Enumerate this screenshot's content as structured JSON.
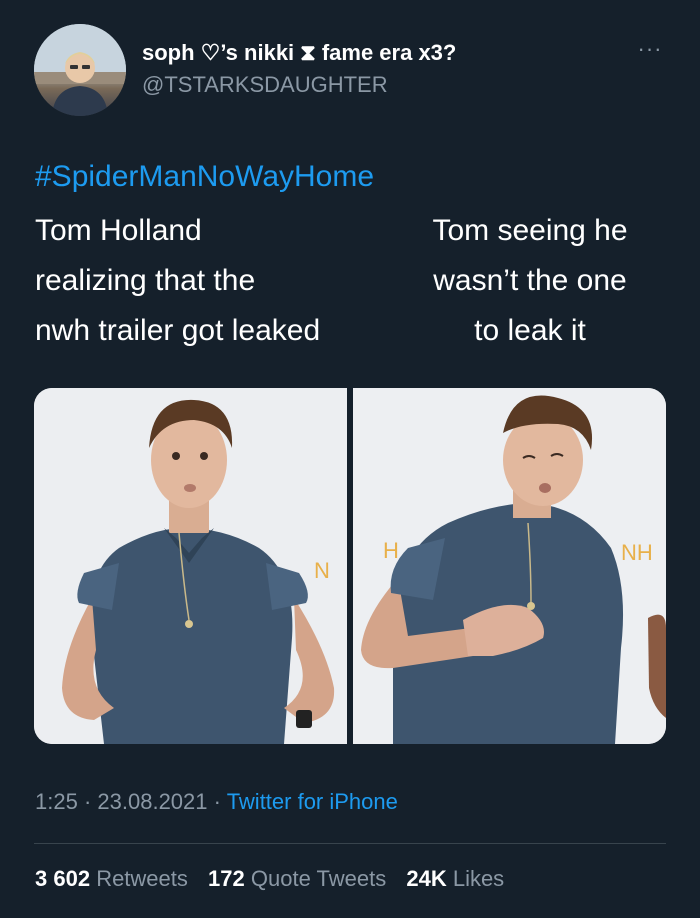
{
  "user": {
    "display_name": "soph ♡’s nikki ⧗ fame era x3?",
    "handle": "@TSTARKSDAUGHTER"
  },
  "menu_icon": "more-dots-icon",
  "tweet": {
    "hashtag": "#SpiderManNoWayHome",
    "left_lines": [
      "Tom Holland",
      "realizing that the",
      "nwh trailer got leaked"
    ],
    "right_lines": [
      "Tom seeing he",
      "wasn’t the one",
      "to leak it"
    ]
  },
  "media": {
    "photo_left_sign": "N",
    "photo_right_sign_left": "H",
    "photo_right_sign_right": "NH"
  },
  "meta": {
    "time": "1:25",
    "date": "23.08.2021",
    "separator": "·",
    "source": "Twitter for iPhone"
  },
  "stats": {
    "retweets_count": "3 602",
    "retweets_label": "Retweets",
    "quotes_count": "172",
    "quotes_label": "Quote Tweets",
    "likes_count": "24K",
    "likes_label": "Likes"
  },
  "colors": {
    "background": "#15202b",
    "link": "#1d9bf0",
    "secondary_text": "#8b98a5",
    "divider": "#38444d"
  }
}
